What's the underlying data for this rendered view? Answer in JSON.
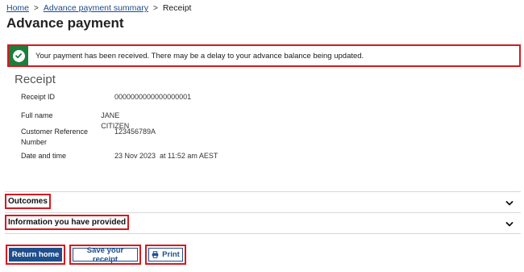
{
  "breadcrumb": {
    "home": "Home",
    "separator": ">",
    "summary": "Advance payment summary",
    "current": "Receipt"
  },
  "page": {
    "title": "Advance payment"
  },
  "alert": {
    "icon": "check-circle-icon",
    "message": "Your payment has been received. There may be a delay to your advance balance being updated."
  },
  "receipt": {
    "heading": "Receipt",
    "rows": [
      {
        "label": "Receipt ID",
        "value": "0000000000000000001"
      },
      {
        "label": "Full name",
        "value": "JANE CITIZEN"
      },
      {
        "label": "Customer Reference Number",
        "value": "123456789A"
      },
      {
        "label": "Date and time",
        "value": "23 Nov 2023  at 11:52 am AEST"
      }
    ]
  },
  "accordions": [
    {
      "title": "Outcomes",
      "icon": "chevron-down-icon"
    },
    {
      "title": "Information you have provided",
      "icon": "chevron-down-icon"
    }
  ],
  "actions": {
    "return_home": "Return home",
    "save_receipt": "Save your receipt",
    "print": "Print",
    "print_icon": "printer-icon"
  },
  "colors": {
    "primary": "#1f4e8c",
    "success": "#1b7f3b",
    "highlight": "#d71920"
  }
}
